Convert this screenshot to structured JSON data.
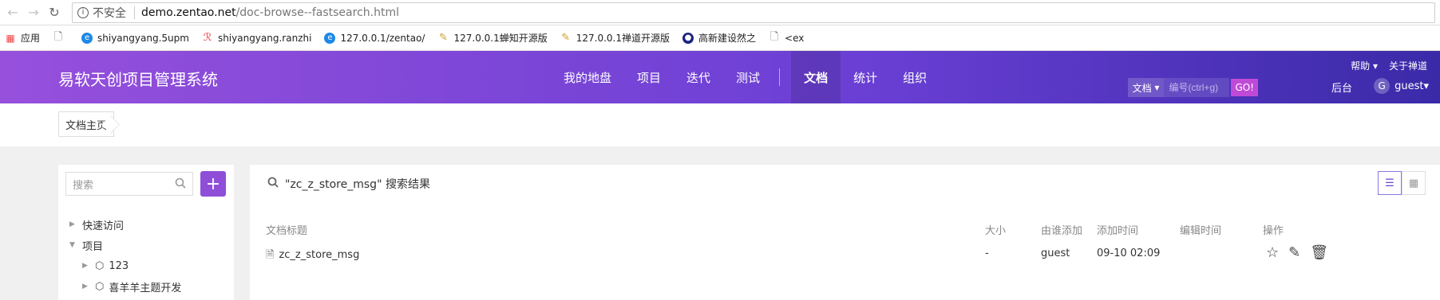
{
  "browser": {
    "security_label": "不安全",
    "url_host": "demo.zentao.net",
    "url_path": "/doc-browse--fastsearch.html",
    "bookmarks": [
      {
        "label": "应用",
        "icon": "apps-grid-icon"
      },
      {
        "label": "",
        "icon": "page-icon"
      },
      {
        "label": "shiyangyang.5upm",
        "icon": "blue-logo-icon"
      },
      {
        "label": "shiyangyang.ranzhi",
        "icon": "red-logo-icon"
      },
      {
        "label": "127.0.0.1/zentao/",
        "icon": "blue-logo-icon"
      },
      {
        "label": "127.0.0.1蝉知开源版",
        "icon": "edit-icon"
      },
      {
        "label": "127.0.0.1禅道开源版",
        "icon": "edit-icon"
      },
      {
        "label": "高新建设然之",
        "icon": "dark-logo-icon"
      },
      {
        "label": "<ex",
        "icon": "page-icon"
      }
    ]
  },
  "header": {
    "brand": "易软天创项目管理系统",
    "nav": [
      {
        "label": "我的地盘"
      },
      {
        "label": "项目"
      },
      {
        "label": "迭代"
      },
      {
        "label": "测试"
      },
      {
        "label": "文档",
        "active": true
      },
      {
        "label": "统计"
      },
      {
        "label": "组织"
      }
    ],
    "help": "帮助",
    "about": "关于禅道",
    "search_type": "文档",
    "search_placeholder": "编号(ctrl+g)",
    "go": "GO!",
    "admin": "后台",
    "user_initial": "G",
    "user": "guest"
  },
  "breadcrumb": {
    "label": "文档主页"
  },
  "sidebar": {
    "search_placeholder": "搜索",
    "add": "+",
    "tree": [
      {
        "label": "快速访问",
        "expanded": false,
        "level": 0
      },
      {
        "label": "项目",
        "expanded": true,
        "level": 0
      },
      {
        "label": "123",
        "level": 1
      },
      {
        "label": "喜羊羊主题开发",
        "level": 1
      }
    ]
  },
  "content": {
    "result_title": "\"zc_z_store_msg\" 搜索结果",
    "columns": {
      "title": "文档标题",
      "size": "大小",
      "added_by": "由谁添加",
      "added_time": "添加时间",
      "edited_time": "编辑时间",
      "actions": "操作"
    },
    "rows": [
      {
        "title": "zc_z_store_msg",
        "size": "-",
        "added_by": "guest",
        "added_time": "09-10 02:09",
        "edited_time": ""
      }
    ]
  },
  "colors": {
    "header_start": "#9650dc",
    "header_end": "#3a2aa8",
    "accent": "#8e4ed8"
  }
}
